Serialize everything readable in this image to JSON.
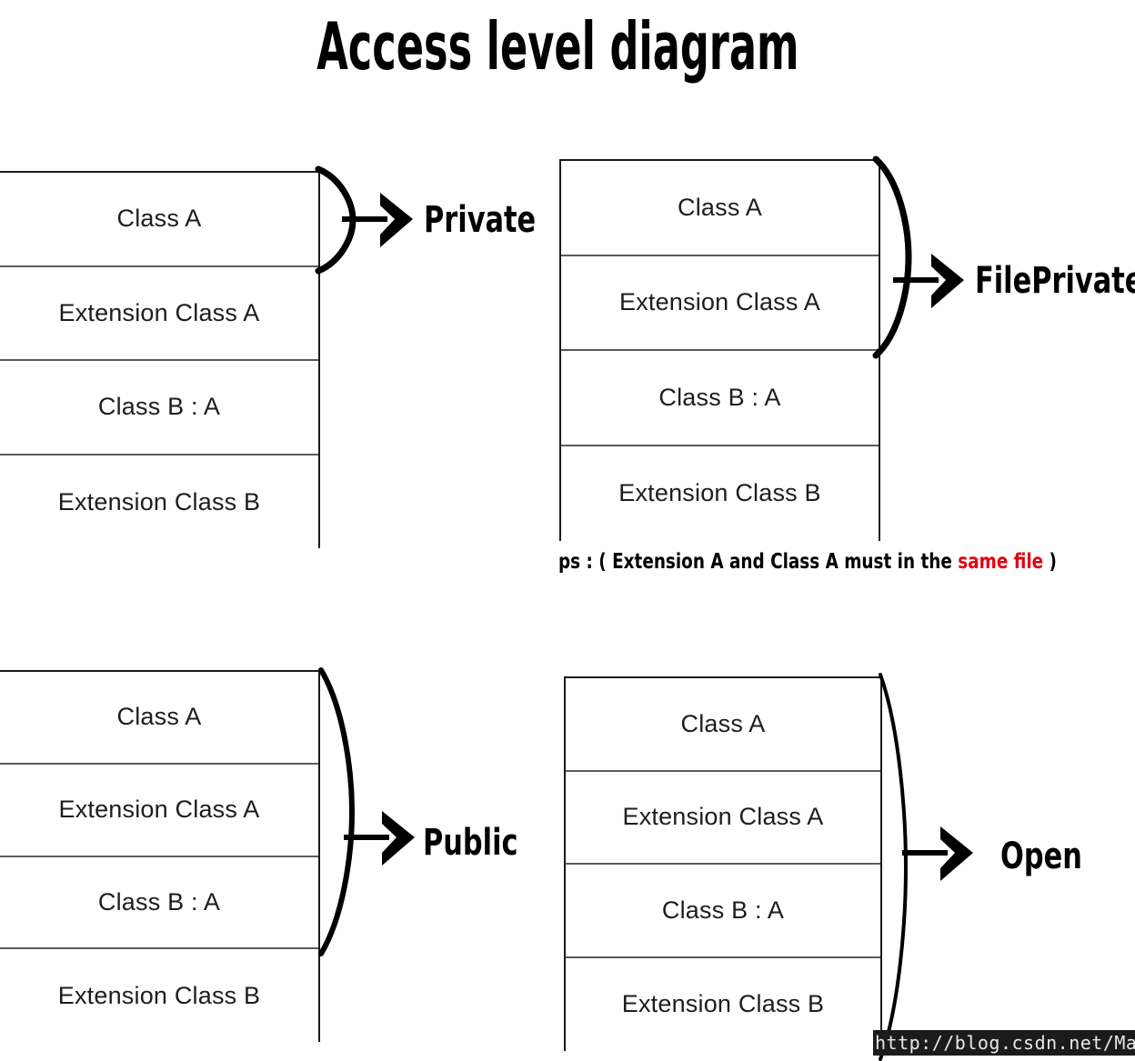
{
  "title": "Access level diagram",
  "rows_common": [
    "Class A",
    "Extension Class A",
    "Class B : A",
    "Extension Class B"
  ],
  "blocks": [
    {
      "id": "private",
      "label": "Private",
      "brace_span_rows": 1,
      "rows": [
        "Class A",
        "Extension Class A",
        "Class B : A",
        "Extension Class B"
      ]
    },
    {
      "id": "fileprivate",
      "label": "FilePrivate",
      "brace_span_rows": 2,
      "rows": [
        "Class A",
        "Extension Class A",
        "Class B : A",
        "Extension Class B"
      ]
    },
    {
      "id": "public",
      "label": "Public",
      "brace_span_rows": 3,
      "rows": [
        "Class A",
        "Extension Class A",
        "Class B : A",
        "Extension Class B"
      ]
    },
    {
      "id": "open",
      "label": "Open",
      "brace_span_rows": 4,
      "rows": [
        "Class A",
        "Extension Class A",
        "Class B : A",
        "Extension Class B"
      ]
    }
  ],
  "note": {
    "prefix": "ps : ( Extension A and Class A must in the ",
    "highlight": "same file",
    "suffix": " )",
    "highlight_color": "#e60012"
  },
  "watermark": "http://blog.csdn.net/Mazy_ma",
  "colors": {
    "box_border": "#1a1a1a",
    "row_divider": "#5b5b5b",
    "text": "#1d1d1d",
    "accent_red": "#e60012",
    "background": "#ffffff"
  }
}
